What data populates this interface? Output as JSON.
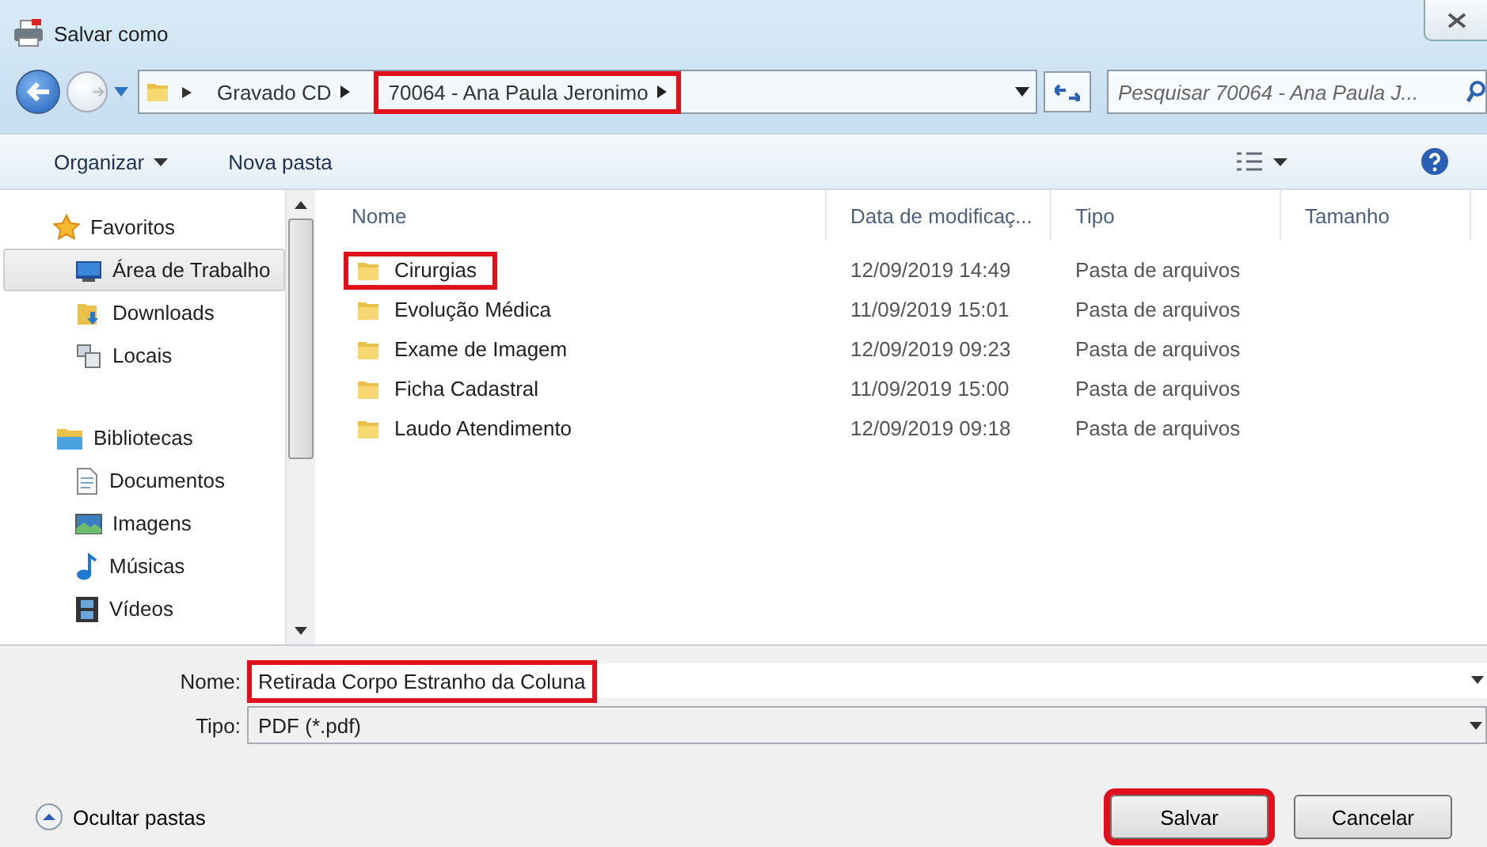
{
  "window": {
    "title": "Salvar como"
  },
  "address": {
    "segments": [
      {
        "label": "Gravado CD",
        "highlighted": false
      },
      {
        "label": "70064 - Ana Paula Jeronimo",
        "highlighted": true
      }
    ]
  },
  "search": {
    "placeholder": "Pesquisar 70064 - Ana Paula J..."
  },
  "toolbar": {
    "organize": "Organizar",
    "new_folder": "Nova pasta"
  },
  "sidebar": {
    "groups": [
      {
        "label": "Favoritos",
        "children": [
          {
            "label": "Área de Trabalho",
            "selected": true
          },
          {
            "label": "Downloads",
            "selected": false
          },
          {
            "label": "Locais",
            "selected": false
          }
        ]
      },
      {
        "label": "Bibliotecas",
        "children": [
          {
            "label": "Documentos",
            "selected": false
          },
          {
            "label": "Imagens",
            "selected": false
          },
          {
            "label": "Músicas",
            "selected": false
          },
          {
            "label": "Vídeos",
            "selected": false
          }
        ]
      }
    ]
  },
  "table": {
    "columns": [
      "Nome",
      "Data de modificaç...",
      "Tipo",
      "Tamanho"
    ],
    "rows": [
      {
        "name": "Cirurgias",
        "date": "12/09/2019 14:49",
        "type": "Pasta de arquivos",
        "highlighted": true
      },
      {
        "name": "Evolução Médica",
        "date": "11/09/2019 15:01",
        "type": "Pasta de arquivos",
        "highlighted": false
      },
      {
        "name": "Exame de Imagem",
        "date": "12/09/2019 09:23",
        "type": "Pasta de arquivos",
        "highlighted": false
      },
      {
        "name": "Ficha Cadastral",
        "date": "11/09/2019 15:00",
        "type": "Pasta de arquivos",
        "highlighted": false
      },
      {
        "name": "Laudo Atendimento",
        "date": "12/09/2019 09:18",
        "type": "Pasta de arquivos",
        "highlighted": false
      }
    ]
  },
  "form": {
    "name_label": "Nome:",
    "name_value": "Retirada Corpo Estranho da Coluna",
    "name_highlighted": true,
    "type_label": "Tipo:",
    "type_value": "PDF (*.pdf)"
  },
  "footer": {
    "hide_folders": "Ocultar pastas",
    "buttons": [
      {
        "label": "Salvar",
        "highlighted": true
      },
      {
        "label": "Cancelar",
        "highlighted": false
      }
    ]
  }
}
